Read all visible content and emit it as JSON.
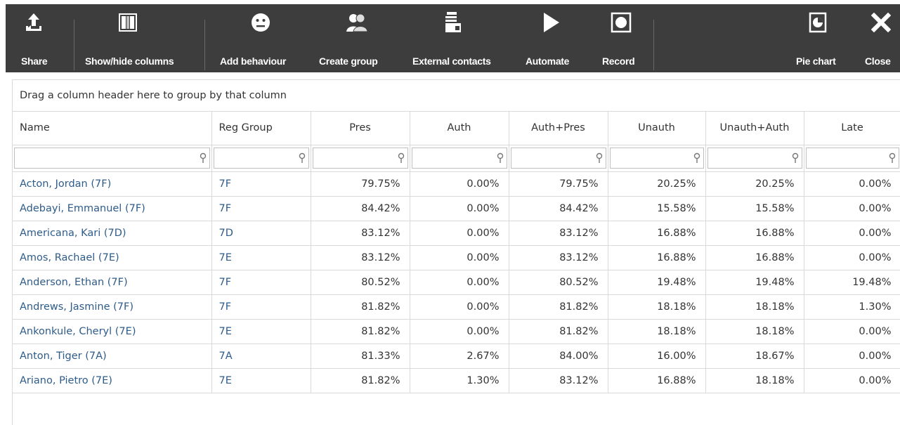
{
  "toolbar": {
    "buttons": [
      {
        "label": "Share",
        "icon": "share-icon"
      },
      {
        "label": "Show/hide columns",
        "icon": "columns-icon"
      },
      {
        "label": "Add behaviour",
        "icon": "behaviour-face-icon"
      },
      {
        "label": "Create group",
        "icon": "group-people-icon"
      },
      {
        "label": "External contacts",
        "icon": "contacts-card-icon"
      },
      {
        "label": "Automate",
        "icon": "play-icon"
      },
      {
        "label": "Record",
        "icon": "record-icon"
      },
      {
        "label": "Pie chart",
        "icon": "pie-chart-icon"
      },
      {
        "label": "Close",
        "icon": "close-icon"
      }
    ]
  },
  "grid": {
    "group_hint": "Drag a column header here to group by that column",
    "columns": [
      "Name",
      "Reg Group",
      "Pres",
      "Auth",
      "Auth+Pres",
      "Unauth",
      "Unauth+Auth",
      "Late"
    ],
    "rows": [
      [
        "Acton, Jordan (7F)",
        "7F",
        "79.75%",
        "0.00%",
        "79.75%",
        "20.25%",
        "20.25%",
        "0.00%"
      ],
      [
        "Adebayi, Emmanuel (7F)",
        "7F",
        "84.42%",
        "0.00%",
        "84.42%",
        "15.58%",
        "15.58%",
        "0.00%"
      ],
      [
        "Americana, Kari (7D)",
        "7D",
        "83.12%",
        "0.00%",
        "83.12%",
        "16.88%",
        "16.88%",
        "0.00%"
      ],
      [
        "Amos, Rachael (7E)",
        "7E",
        "83.12%",
        "0.00%",
        "83.12%",
        "16.88%",
        "16.88%",
        "0.00%"
      ],
      [
        "Anderson, Ethan (7F)",
        "7F",
        "80.52%",
        "0.00%",
        "80.52%",
        "19.48%",
        "19.48%",
        "19.48%"
      ],
      [
        "Andrews, Jasmine (7F)",
        "7F",
        "81.82%",
        "0.00%",
        "81.82%",
        "18.18%",
        "18.18%",
        "1.30%"
      ],
      [
        "Ankonkule, Cheryl (7E)",
        "7E",
        "81.82%",
        "0.00%",
        "81.82%",
        "18.18%",
        "18.18%",
        "0.00%"
      ],
      [
        "Anton, Tiger (7A)",
        "7A",
        "81.33%",
        "2.67%",
        "84.00%",
        "16.00%",
        "18.67%",
        "0.00%"
      ],
      [
        "Ariano, Pietro (7E)",
        "7E",
        "81.82%",
        "1.30%",
        "83.12%",
        "16.88%",
        "18.18%",
        "0.00%"
      ]
    ]
  }
}
